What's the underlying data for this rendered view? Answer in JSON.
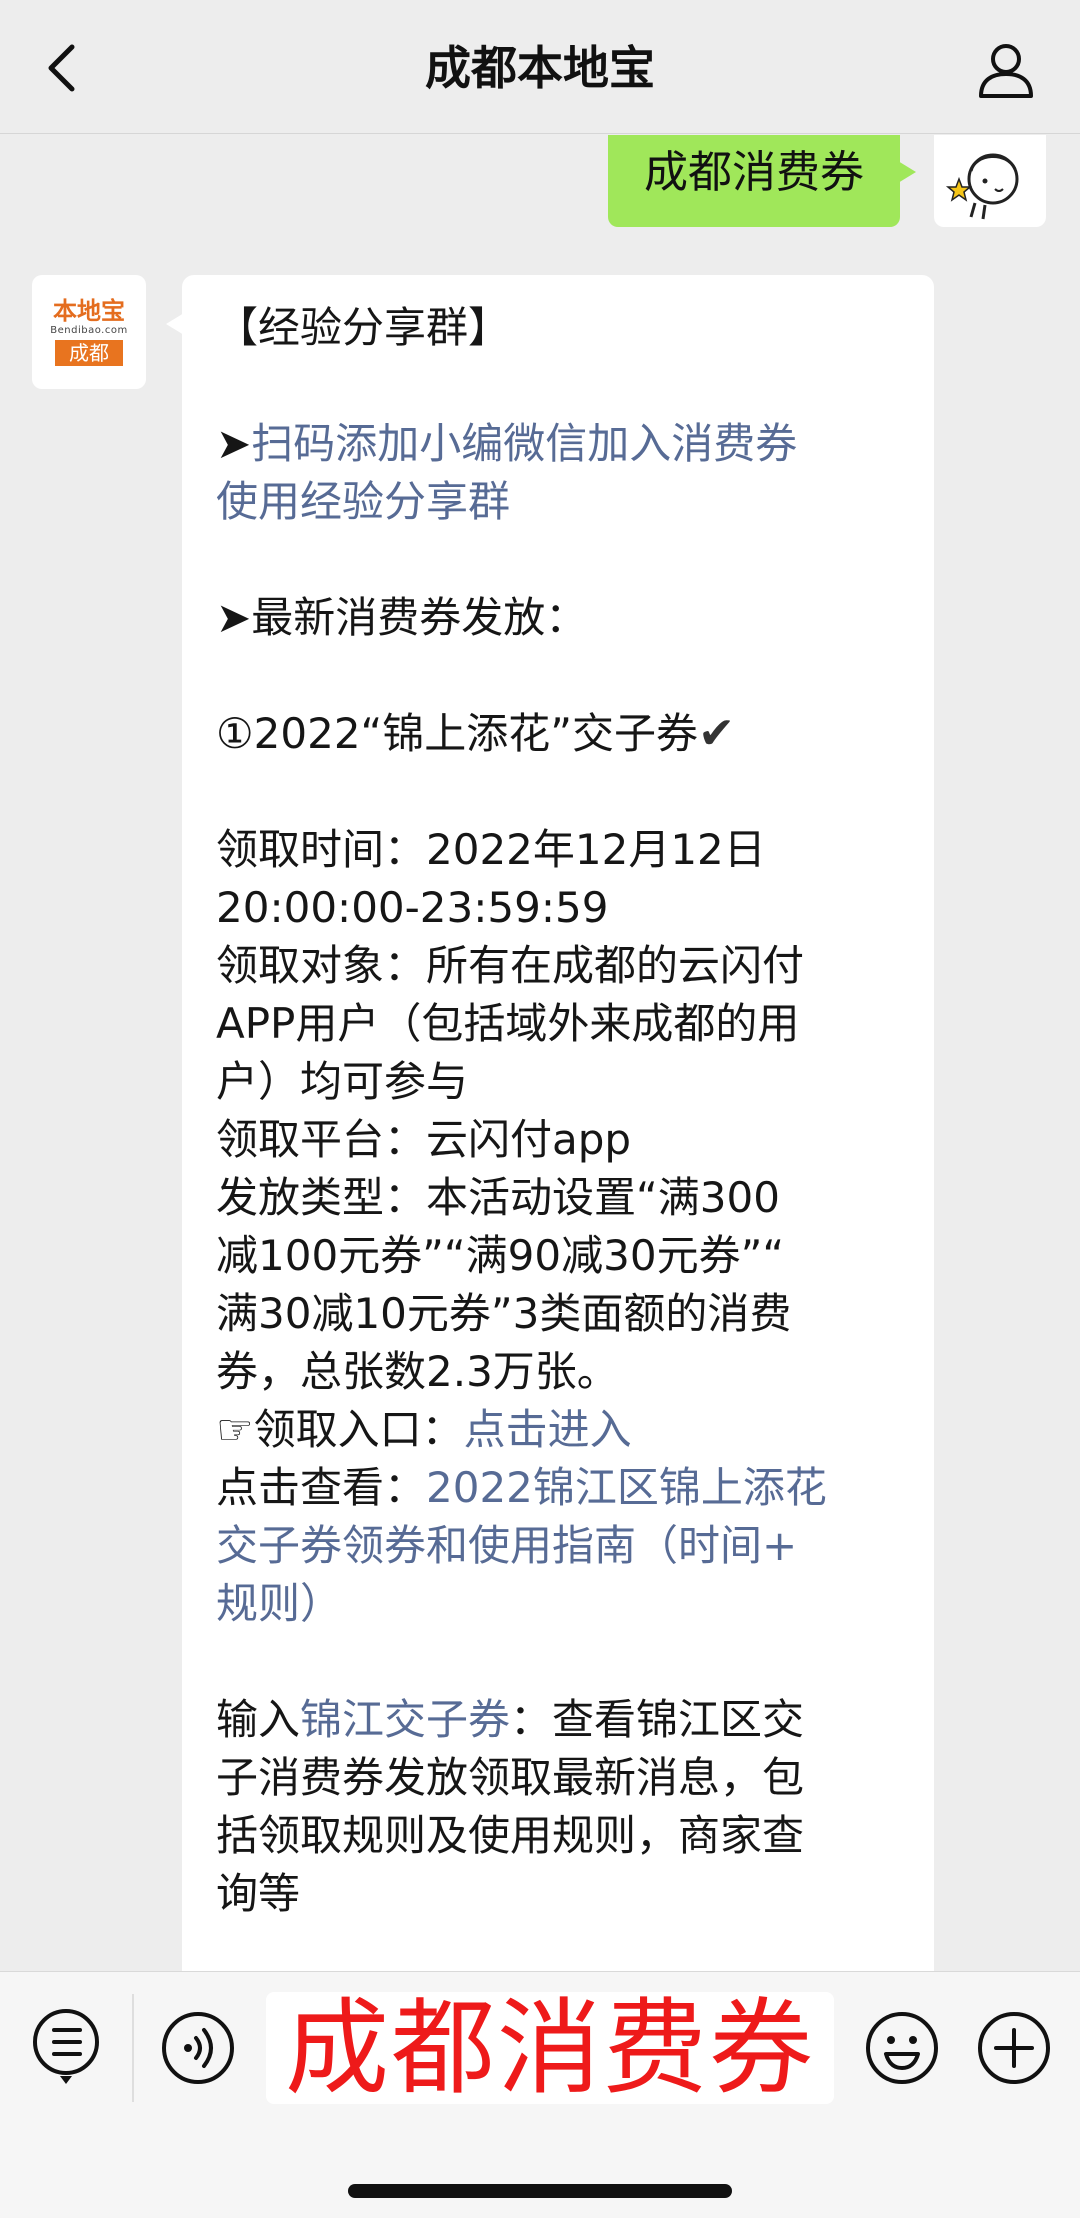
{
  "header": {
    "title": "成都本地宝"
  },
  "sent_message": {
    "text": "成都消费券"
  },
  "avatar_bdb": {
    "logo_text": "本地宝",
    "logo_url_text": "Bendibao.com",
    "logo_city": "成都"
  },
  "reply": {
    "group_title": "【经验分享群】",
    "scan_prefix": "➤",
    "scan_link_line1": "扫码添加小编微信加入消费券",
    "scan_link_line2": "使用经验分享群",
    "latest_heading": "➤最新消费券发放：",
    "item_title": "①2022“锦上添花”交子券",
    "item_check": "✔",
    "time_line1": "领取时间：2022年12月12日",
    "time_line2": "20:00:00-23:59:59",
    "target_line1": "领取对象：所有在成都的云闪付",
    "target_line2": "APP用户（包括域外来成都的用",
    "target_line3": "户）均可参与",
    "platform_line": "领取平台：云闪付app",
    "type_line1": "发放类型：本活动设置“满300",
    "type_line2": "减100元券”“满90减30元券”“",
    "type_line3": "满30减10元券”3类面额的消费",
    "type_line4": "券，总张数2.3万张。",
    "entry_prefix": "☞领取入口：",
    "entry_link": "点击进入",
    "view_prefix": "点击查看：",
    "view_link_line1": "2022锦江区锦上添花",
    "view_link_line2": "交子券领券和使用指南（时间+",
    "view_link_line3": "规则）",
    "input_prefix": "输入",
    "input_link": "锦江交子券",
    "input_rest_line1": "：查看锦江区交",
    "input_rest_line2": "子消费券发放领取最新消息，包",
    "input_rest_line3": "括领取规则及使用规则，商家查",
    "input_rest_line4": "询等"
  },
  "bottom_bar": {
    "input_text": "成都消费券"
  },
  "colors": {
    "link": "#576b95",
    "sent_bubble": "#a0e75a",
    "overlay_text": "#ee1a1a"
  }
}
